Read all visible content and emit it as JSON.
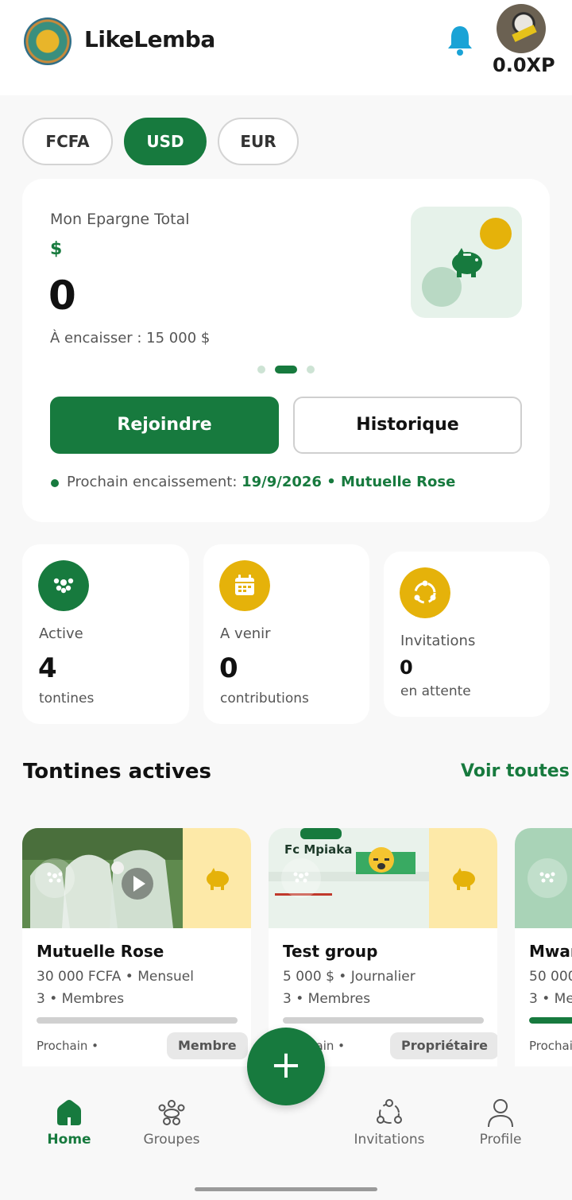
{
  "header": {
    "app_title": "LikeLemba",
    "xp": "0.0XP"
  },
  "currencies": [
    {
      "label": "FCFA",
      "active": false
    },
    {
      "label": "USD",
      "active": true
    },
    {
      "label": "EUR",
      "active": false
    }
  ],
  "savings": {
    "title": "Mon Epargne Total",
    "symbol": "$",
    "amount": "0",
    "to_collect": "À encaisser : 15 000 $",
    "carousel_active_index": 1,
    "join_label": "Rejoindre",
    "history_label": "Historique",
    "next_label": "Prochain encaissement: ",
    "next_value": "19/9/2026 • Mutuelle Rose"
  },
  "stats": [
    {
      "label": "Active",
      "value": "4",
      "unit": "tontines",
      "icon": "group-icon",
      "color": "#177a3e"
    },
    {
      "label": "A venir",
      "value": "0",
      "unit": "contributions",
      "icon": "calendar-icon",
      "color": "#e5b20a"
    },
    {
      "label": "Invitations",
      "value": "0",
      "unit": "en attente",
      "icon": "invitations-icon",
      "color": "#e5b20a"
    }
  ],
  "active_section": {
    "title": "Tontines actives",
    "see_all": "Voir toutes"
  },
  "tontines": [
    {
      "name": "Mutuelle Rose",
      "amount_freq": "30 000 FCFA • Mensuel",
      "members": "3 • Membres",
      "next": "Prochain •",
      "role": "Membre",
      "progress": 0
    },
    {
      "name": "Test group",
      "amount_freq": "5 000 $ • Journalier",
      "members": "3 • Membres",
      "next": "Prochain •",
      "role": "Propriétaire",
      "progress": 0,
      "photo_text": "Fc Mpiaka"
    },
    {
      "name": "Mwan",
      "amount_freq": "50 000",
      "members": "3 • Mem",
      "next": "Prochai",
      "role": "",
      "progress": 0.35
    }
  ],
  "nav": [
    {
      "label": "Home",
      "icon": "home-icon",
      "active": true
    },
    {
      "label": "Groupes",
      "icon": "groups-icon",
      "active": false
    },
    {
      "label": "Invitations",
      "icon": "invitations-icon",
      "active": false
    },
    {
      "label": "Profile",
      "icon": "profile-icon",
      "active": false
    }
  ],
  "fab_label": "+",
  "colors": {
    "primary": "#177a3e",
    "accent": "#e5b20a",
    "bell": "#1aa3d6"
  }
}
